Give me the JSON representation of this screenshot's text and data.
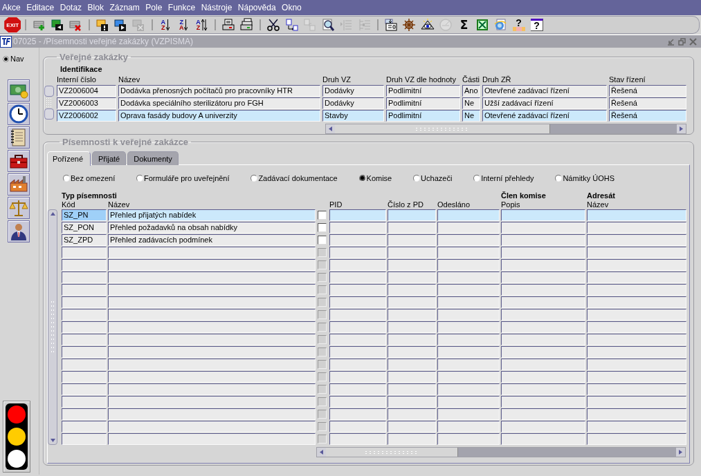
{
  "menu": [
    {
      "label": "Akce"
    },
    {
      "label": "Editace"
    },
    {
      "label": "Dotaz"
    },
    {
      "label": "Blok"
    },
    {
      "label": "Záznam"
    },
    {
      "label": "Pole"
    },
    {
      "label": "Funkce"
    },
    {
      "label": "Nástroje"
    },
    {
      "label": "Nápověda"
    },
    {
      "label": "Okno"
    }
  ],
  "toolbar": [
    {
      "kind": "exit",
      "text": "EXIT",
      "disabled": false
    },
    {
      "kind": "separator"
    },
    {
      "kind": "add-record",
      "disabled": false
    },
    {
      "kind": "save-record",
      "disabled": false
    },
    {
      "kind": "delete-record",
      "disabled": false
    },
    {
      "kind": "separator"
    },
    {
      "kind": "enter-query",
      "disabled": false
    },
    {
      "kind": "execute-query",
      "disabled": false
    },
    {
      "kind": "cancel-query",
      "disabled": true
    },
    {
      "kind": "separator"
    },
    {
      "kind": "sort",
      "text": "AZ",
      "disabled": false
    },
    {
      "kind": "sort",
      "text": "ZA",
      "disabled": false
    },
    {
      "kind": "sort-multi",
      "text": "AZ",
      "disabled": false
    },
    {
      "kind": "separator"
    },
    {
      "kind": "print",
      "disabled": false
    },
    {
      "kind": "print-setup",
      "disabled": false
    },
    {
      "kind": "separator"
    },
    {
      "kind": "cut",
      "disabled": false
    },
    {
      "kind": "copy",
      "disabled": false
    },
    {
      "kind": "paste",
      "disabled": true
    },
    {
      "kind": "zoom",
      "disabled": false
    },
    {
      "kind": "list",
      "disabled": true
    },
    {
      "kind": "tree-list",
      "disabled": true
    },
    {
      "kind": "separator"
    },
    {
      "kind": "export",
      "disabled": false
    },
    {
      "kind": "wheel",
      "disabled": false
    },
    {
      "kind": "eye",
      "disabled": false
    },
    {
      "kind": "clock",
      "disabled": true
    },
    {
      "kind": "sum",
      "text": "Σ",
      "disabled": false
    },
    {
      "kind": "spreadsheet",
      "disabled": false
    },
    {
      "kind": "browser",
      "disabled": false
    },
    {
      "kind": "help-lock",
      "text": "?",
      "disabled": false
    },
    {
      "kind": "help",
      "text": "?",
      "disabled": false
    }
  ],
  "window": {
    "title": "07025 - /Písemnosti veřejné zakázky (VZPISMA)"
  },
  "nav": {
    "label": "Nav",
    "selected": true
  },
  "sidebar": [
    {
      "kind": "money"
    },
    {
      "kind": "clock"
    },
    {
      "kind": "notebook"
    },
    {
      "kind": "toolbox"
    },
    {
      "kind": "factory"
    },
    {
      "kind": "scales"
    },
    {
      "kind": "person"
    }
  ],
  "contracts": {
    "legend": "Veřejné zakázky",
    "group": "Identifikace",
    "columns": [
      "Interní číslo",
      "Název",
      "Druh VZ",
      "Druh VZ dle hodnoty",
      "Části",
      "Druh ZŘ",
      "Stav řízení"
    ],
    "rows": [
      {
        "cells": [
          "VZ2006004",
          "Dodávka přenosných počítačů pro pracovníky HTR",
          "Dodávky",
          "Podlimitní",
          "Ano",
          "Otevřené zadávací řízení",
          "Řešená"
        ],
        "selected": false
      },
      {
        "cells": [
          "VZ2006003",
          "Dodávka speciálního sterilizátoru pro FGH",
          "Dodávky",
          "Podlimitní",
          "Ne",
          "Užší zadávací řízení",
          "Řešená"
        ],
        "selected": false
      },
      {
        "cells": [
          "VZ2006002",
          "Oprava fasády budovy A univerzity",
          "Stavby",
          "Podlimitní",
          "Ne",
          "Otevřené zadávací řízení",
          "Řešená"
        ],
        "selected": true
      }
    ]
  },
  "documents": {
    "legend": "Písemnosti k veřejné zakázce",
    "tabs": [
      {
        "label": "Pořízené",
        "selected": true
      },
      {
        "label": "Přijaté",
        "selected": false
      },
      {
        "label": "Dokumenty",
        "selected": false
      }
    ],
    "filters": [
      {
        "label": "Bez omezení",
        "selected": false
      },
      {
        "label": "Formuláře pro uveřejnění",
        "selected": false
      },
      {
        "label": "Zadávací dokumentace",
        "selected": false
      },
      {
        "label": "Komise",
        "selected": true
      },
      {
        "label": "Uchazeči",
        "selected": false
      },
      {
        "label": "Interní přehledy",
        "selected": false
      },
      {
        "label": "Námitky ÚOHS",
        "selected": false
      }
    ],
    "columns": [
      {
        "label": "Kód",
        "group": "Typ písemnosti"
      },
      {
        "label": "Název"
      },
      {
        "label": "PID"
      },
      {
        "label": "Číslo z PD"
      },
      {
        "label": "Odesláno"
      },
      {
        "label": "Popis",
        "group": "Člen komise"
      },
      {
        "label": "Název",
        "group": "Adresát"
      }
    ],
    "rows": [
      {
        "code": "SZ_PN",
        "name": "Přehled přijatých nabídek",
        "checked": false,
        "disabled": false,
        "selected": true
      },
      {
        "code": "SZ_PON",
        "name": "Přehled požadavků na obsah nabídky",
        "checked": false,
        "disabled": false,
        "selected": false
      },
      {
        "code": "SZ_ZPD",
        "name": "Přehled zadávacích podmínek",
        "checked": false,
        "disabled": false,
        "selected": false
      },
      {
        "checked": false,
        "disabled": true,
        "selected": false
      },
      {
        "checked": false,
        "disabled": true,
        "selected": false
      },
      {
        "checked": false,
        "disabled": true,
        "selected": false
      },
      {
        "checked": false,
        "disabled": true,
        "selected": false
      },
      {
        "checked": false,
        "disabled": true,
        "selected": false
      },
      {
        "checked": false,
        "disabled": true,
        "selected": false
      },
      {
        "checked": false,
        "disabled": true,
        "selected": false
      },
      {
        "checked": false,
        "disabled": true,
        "selected": false
      },
      {
        "checked": false,
        "disabled": true,
        "selected": false
      },
      {
        "checked": false,
        "disabled": true,
        "selected": false
      },
      {
        "checked": false,
        "disabled": true,
        "selected": false
      },
      {
        "checked": false,
        "disabled": true,
        "selected": false
      },
      {
        "checked": false,
        "disabled": true,
        "selected": false
      },
      {
        "checked": false,
        "disabled": true,
        "selected": false
      },
      {
        "checked": false,
        "disabled": true,
        "selected": false
      },
      {
        "checked": false,
        "disabled": true,
        "selected": false
      }
    ]
  }
}
